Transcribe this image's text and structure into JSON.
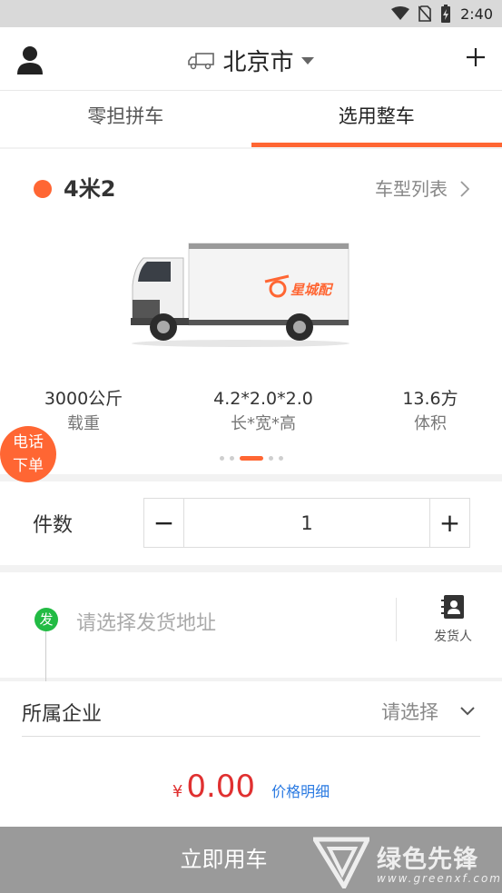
{
  "status_bar": {
    "time": "2:40",
    "icons": [
      "wifi-icon",
      "no-sim-icon",
      "battery-charging-icon"
    ]
  },
  "header": {
    "city": "北京市",
    "icons": [
      "user-icon",
      "truck-outline-icon",
      "caret-down-icon",
      "plus-icon"
    ]
  },
  "tabs": [
    {
      "label": "零担拼车",
      "active": false
    },
    {
      "label": "选用整车",
      "active": true
    }
  ],
  "vehicle": {
    "type_name": "4米2",
    "list_label": "车型列表",
    "brand_text": "星城配",
    "specs": [
      {
        "value": "3000公斤",
        "label": "载重"
      },
      {
        "value": "4.2*2.0*2.0",
        "label": "长*宽*高"
      },
      {
        "value": "13.6方",
        "label": "体积"
      }
    ],
    "carousel": {
      "count": 5,
      "active_index": 2
    }
  },
  "phone_order": {
    "line1": "电话",
    "line2": "下单"
  },
  "quantity": {
    "label": "件数",
    "minus": "−",
    "plus": "+",
    "value": "1"
  },
  "address": {
    "badge": "发",
    "placeholder": "请选择发货地址",
    "sender_label": "发货人"
  },
  "company": {
    "label": "所属企业",
    "placeholder": "请选择"
  },
  "price": {
    "currency": "¥",
    "amount": "0.00",
    "detail_link": "价格明细"
  },
  "confirm": {
    "label": "立即用车"
  },
  "watermark": {
    "text": "绿色先锋",
    "url": "www.greenxf.com"
  },
  "colors": {
    "accent": "#ff6633",
    "price": "#e03030",
    "link": "#2a7ae2",
    "send_badge": "#22bb44",
    "button_bg": "#9a9a9a"
  }
}
